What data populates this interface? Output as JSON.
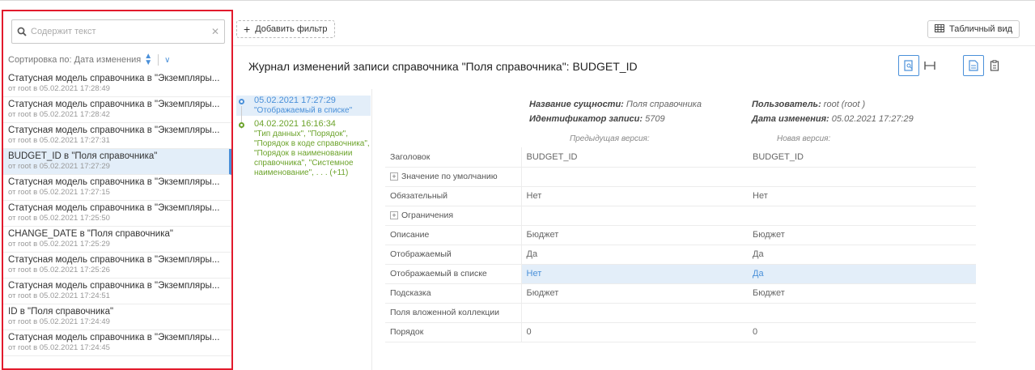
{
  "search": {
    "placeholder": "Содержит текст"
  },
  "sort": {
    "label": "Сортировка по: Дата изменения"
  },
  "list": [
    {
      "title": "Статусная модель справочника в \"Экземпляры...",
      "sub": "от root в 05.02.2021 17:28:49"
    },
    {
      "title": "Статусная модель справочника в \"Экземпляры...",
      "sub": "от root в 05.02.2021 17:28:42"
    },
    {
      "title": "Статусная модель справочника в \"Экземпляры...",
      "sub": "от root в 05.02.2021 17:27:31"
    },
    {
      "title": "BUDGET_ID в \"Поля справочника\"",
      "sub": "от root в 05.02.2021 17:27:29",
      "selected": true
    },
    {
      "title": "Статусная модель справочника в \"Экземпляры...",
      "sub": "от root в 05.02.2021 17:27:15"
    },
    {
      "title": "Статусная модель справочника в \"Экземпляры...",
      "sub": "от root в 05.02.2021 17:25:50"
    },
    {
      "title": "CHANGE_DATE в \"Поля справочника\"",
      "sub": "от root в 05.02.2021 17:25:29"
    },
    {
      "title": "Статусная модель справочника в \"Экземпляры...",
      "sub": "от root в 05.02.2021 17:25:26"
    },
    {
      "title": "Статусная модель справочника в \"Экземпляры...",
      "sub": "от root в 05.02.2021 17:24:51"
    },
    {
      "title": "ID в \"Поля справочника\"",
      "sub": "от root в 05.02.2021 17:24:49"
    },
    {
      "title": "Статусная модель справочника в \"Экземпляры...",
      "sub": "от root в 05.02.2021 17:24:45"
    }
  ],
  "toolbar": {
    "add_filter": "Добавить фильтр",
    "table_view": "Табличный вид"
  },
  "journal_title": "Журнал изменений записи справочника \"Поля справочника\": BUDGET_ID",
  "timeline": [
    {
      "date": "05.02.2021 17:27:29",
      "changes": "\"Отображаемый в списке\"",
      "color": "blue"
    },
    {
      "date": "04.02.2021 16:16:34",
      "changes": "\"Тип данных\", \"Порядок\", \"Порядок в коде справочника\", \"Порядок в наименовании справочника\", \"Системное наименование\", . . . (+11)",
      "color": "green"
    }
  ],
  "meta": {
    "entity_label": "Название сущности:",
    "entity_value": "Поля справочника",
    "record_id_label": "Идентификатор записи:",
    "record_id_value": "5709",
    "user_label": "Пользователь:",
    "user_value": "root (root )",
    "changed_label": "Дата изменения:",
    "changed_value": "05.02.2021 17:27:29"
  },
  "versions": {
    "prev": "Предыдущая версия:",
    "next": "Новая версия:"
  },
  "rows": [
    {
      "label": "Заголовок",
      "prev": "BUDGET_ID",
      "next": "BUDGET_ID"
    },
    {
      "label": "Значение по умолчанию",
      "prev": "",
      "next": "",
      "expand": true
    },
    {
      "label": "Обязательный",
      "prev": "Нет",
      "next": "Нет"
    },
    {
      "label": "Ограничения",
      "prev": "",
      "next": "",
      "expand": true
    },
    {
      "label": "Описание",
      "prev": "Бюджет",
      "next": "Бюджет"
    },
    {
      "label": "Отображаемый",
      "prev": "Да",
      "next": "Да"
    },
    {
      "label": "Отображаемый в списке",
      "prev": "Нет",
      "next": "Да",
      "highlight": true
    },
    {
      "label": "Подсказка",
      "prev": "Бюджет",
      "next": "Бюджет"
    },
    {
      "label": "Поля вложенной коллекции",
      "prev": "",
      "next": ""
    },
    {
      "label": "Порядок",
      "prev": "0",
      "next": "0"
    }
  ],
  "colors": {
    "accent": "#4a90d9",
    "green": "#6ca32b",
    "selection": "#e3eef9",
    "border_highlight": "#e21a2c"
  }
}
